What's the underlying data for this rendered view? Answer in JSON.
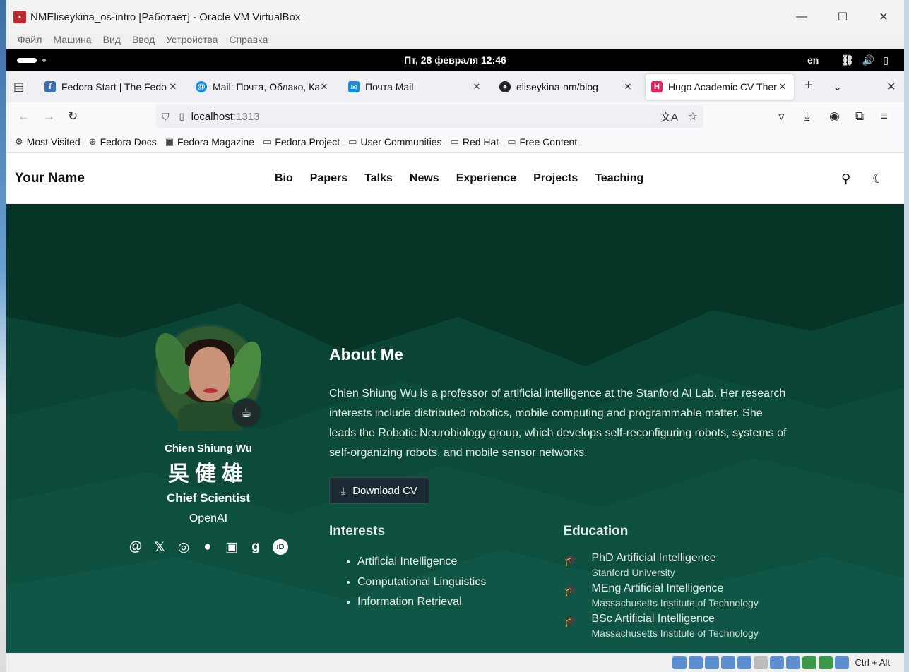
{
  "vbox": {
    "title": "NMEliseykina_os-intro [Работает] - Oracle VM VirtualBox",
    "menu": [
      "Файл",
      "Машина",
      "Вид",
      "Ввод",
      "Устройства",
      "Справка"
    ],
    "hostkey": "Ctrl + Alt"
  },
  "gnome": {
    "clock": "Пт, 28 февраля  12:46",
    "lang": "en"
  },
  "tabs": [
    {
      "label": "Fedora Start | The Fedora",
      "icon": "fedora-icon"
    },
    {
      "label": "Mail: Почта, Облако, Ка",
      "icon": "mail-ru-icon"
    },
    {
      "label": "Почта Mail",
      "icon": "mail-icon"
    },
    {
      "label": "eliseykina-nm/blog",
      "icon": "github-icon"
    },
    {
      "label": "Hugo Academic CV Theme",
      "icon": "hugo-icon"
    }
  ],
  "url": {
    "host": "localhost",
    "port": ":1313"
  },
  "bookmarks": [
    "Most Visited",
    "Fedora Docs",
    "Fedora Magazine",
    "Fedora Project",
    "User Communities",
    "Red Hat",
    "Free Content"
  ],
  "site": {
    "brand": "Your Name",
    "menu": [
      "Bio",
      "Papers",
      "Talks",
      "News",
      "Experience",
      "Projects",
      "Teaching"
    ]
  },
  "profile": {
    "name": "Chien Shiung Wu",
    "chinese": "吳健雄",
    "role": "Chief Scientist",
    "org": "OpenAI",
    "badge": "☕"
  },
  "about": {
    "title": "About Me",
    "bio": "Chien Shiung Wu is a professor of artificial intelligence at the Stanford AI Lab. Her research interests include distributed robotics, mobile computing and programmable matter. She leads the Robotic Neurobiology group, which develops self-reconfiguring robots, systems of self-organizing robots, and mobile sensor networks.",
    "cv_label": "Download CV",
    "interests_title": "Interests",
    "interests": [
      "Artificial Intelligence",
      "Computational Linguistics",
      "Information Retrieval"
    ],
    "education_title": "Education",
    "education": [
      {
        "degree": "PhD Artificial Intelligence",
        "institution": "Stanford University"
      },
      {
        "degree": "MEng Artificial Intelligence",
        "institution": "Massachusetts Institute of Technology"
      },
      {
        "degree": "BSc Artificial Intelligence",
        "institution": "Massachusetts Institute of Technology"
      }
    ]
  },
  "colors": {
    "hero_bg": "#073b2e",
    "accent_red": "#c0262e"
  }
}
